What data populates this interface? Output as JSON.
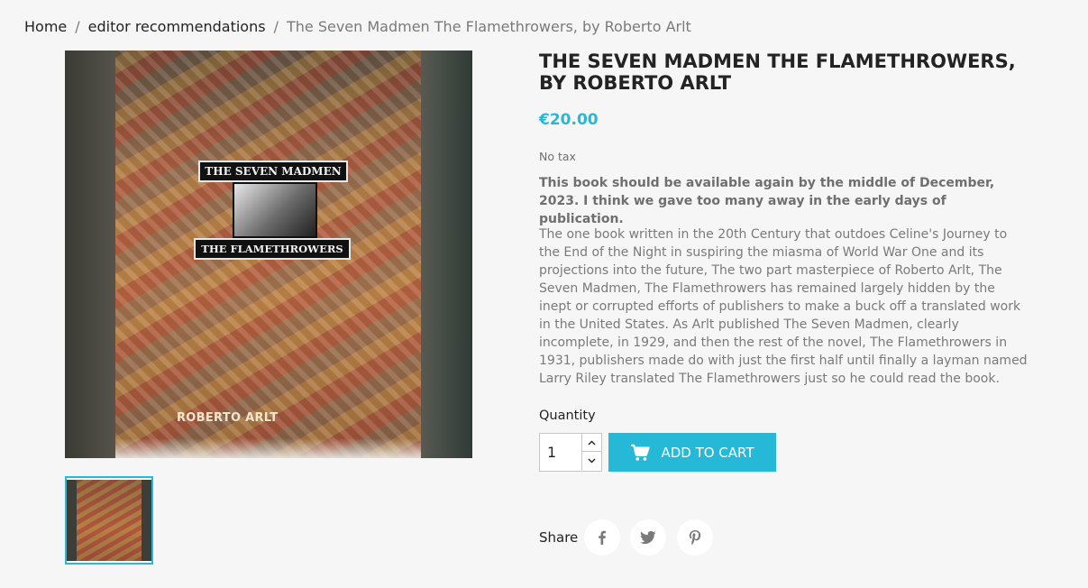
{
  "breadcrumb": {
    "items": [
      "Home",
      "editor recommendations"
    ],
    "separator": "/",
    "current": "The Seven Madmen The Flamethrowers, by Roberto Arlt"
  },
  "product": {
    "title": "THE SEVEN MADMEN THE FLAMETHROWERS, BY ROBERTO ARLT",
    "price": "€20.00",
    "tax_note": "No tax",
    "availability": "This book should be available again by the middle of December, 2023. I think we gave too many away in the early days of publication.",
    "description": "The one book written in the 20th Century that outdoes Celine's Journey to the End of the Night in suspiring the miasma of World War One and its projections into the future, The two part masterpiece of Roberto Arlt, The Seven Madmen, The Flamethrowers has remained largely hidden by the inept or corrupted efforts of publishers to make a buck off a translated work in the United States. As Arlt published The Seven Madmen, clearly incomplete, in 1929, and then the rest of the novel, The Flamethrowers in 1931, publishers made do with just the first half until finally a layman named Larry Riley translated The Flamethrowers just so he could read the book."
  },
  "cover": {
    "title_label": "THE SEVEN MADMEN",
    "subtitle_label": "THE FLAMETHROWERS",
    "author_label": "ROBERTO ARLT"
  },
  "purchase": {
    "quantity_label": "Quantity",
    "quantity_value": "1",
    "add_to_cart_label": "Add to cart",
    "cart_icon": "shopping-cart-icon"
  },
  "share": {
    "label": "Share",
    "icons": [
      "facebook-icon",
      "twitter-icon",
      "pinterest-icon"
    ]
  },
  "colors": {
    "accent": "#25b9d7",
    "background": "#f6f6f6",
    "text": "#232323",
    "muted": "#7a7a7a"
  }
}
